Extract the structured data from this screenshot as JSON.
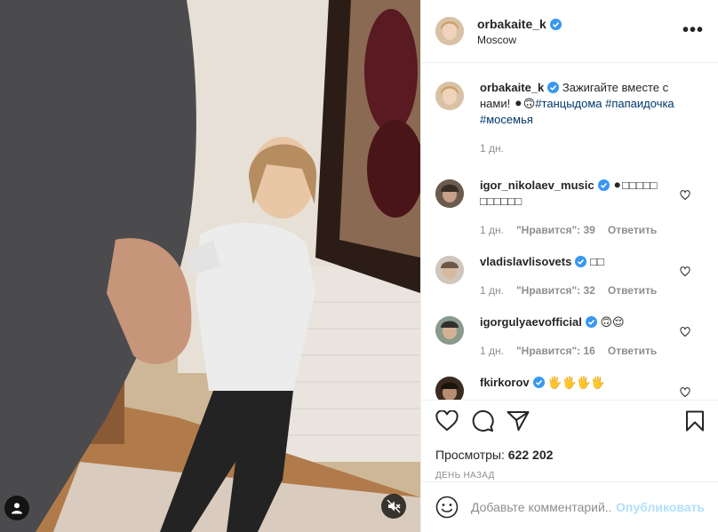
{
  "post": {
    "username": "orbakaite_k",
    "location": "Moscow",
    "more_label": "•••"
  },
  "caption": {
    "username": "orbakaite_k",
    "text": "Зажигайте вместе с нами! ",
    "emoji": "⚫🙃",
    "tags": "#танцыдома #папаидочка #мосемья",
    "time": "1 дн."
  },
  "comments": [
    {
      "username": "igor_nikolaev_music",
      "text": "⚫□□□□□ □□□□□□",
      "time": "1 дн.",
      "likes": "\"Нравится\": 39",
      "reply": "Ответить"
    },
    {
      "username": "vladislavlisovets",
      "text": "□□",
      "time": "1 дн.",
      "likes": "\"Нравится\": 32",
      "reply": "Ответить"
    },
    {
      "username": "igorgulyaevofficial",
      "text": "🙃😌",
      "time": "1 дн.",
      "likes": "\"Нравится\": 16",
      "reply": "Ответить"
    },
    {
      "username": "fkirkorov",
      "text": "🖐🖐🖐🖐",
      "time": "",
      "likes": "",
      "reply": ""
    }
  ],
  "stats": {
    "views_label": "Просмотры:",
    "views_value": "622 202",
    "ago": "день назад"
  },
  "add_comment": {
    "placeholder": "Добавьте комментарий...",
    "post_label": "Опубликовать"
  },
  "colors": {
    "verified": "#3897f0",
    "hashtag": "#00376b",
    "muted": "#8e8e8e",
    "post_disabled": "#b2dffc"
  },
  "icons": [
    "heart-icon",
    "comment-icon",
    "share-icon",
    "bookmark-icon",
    "more-icon",
    "verified-icon",
    "user-tag-icon",
    "mute-icon",
    "emoji-icon"
  ]
}
